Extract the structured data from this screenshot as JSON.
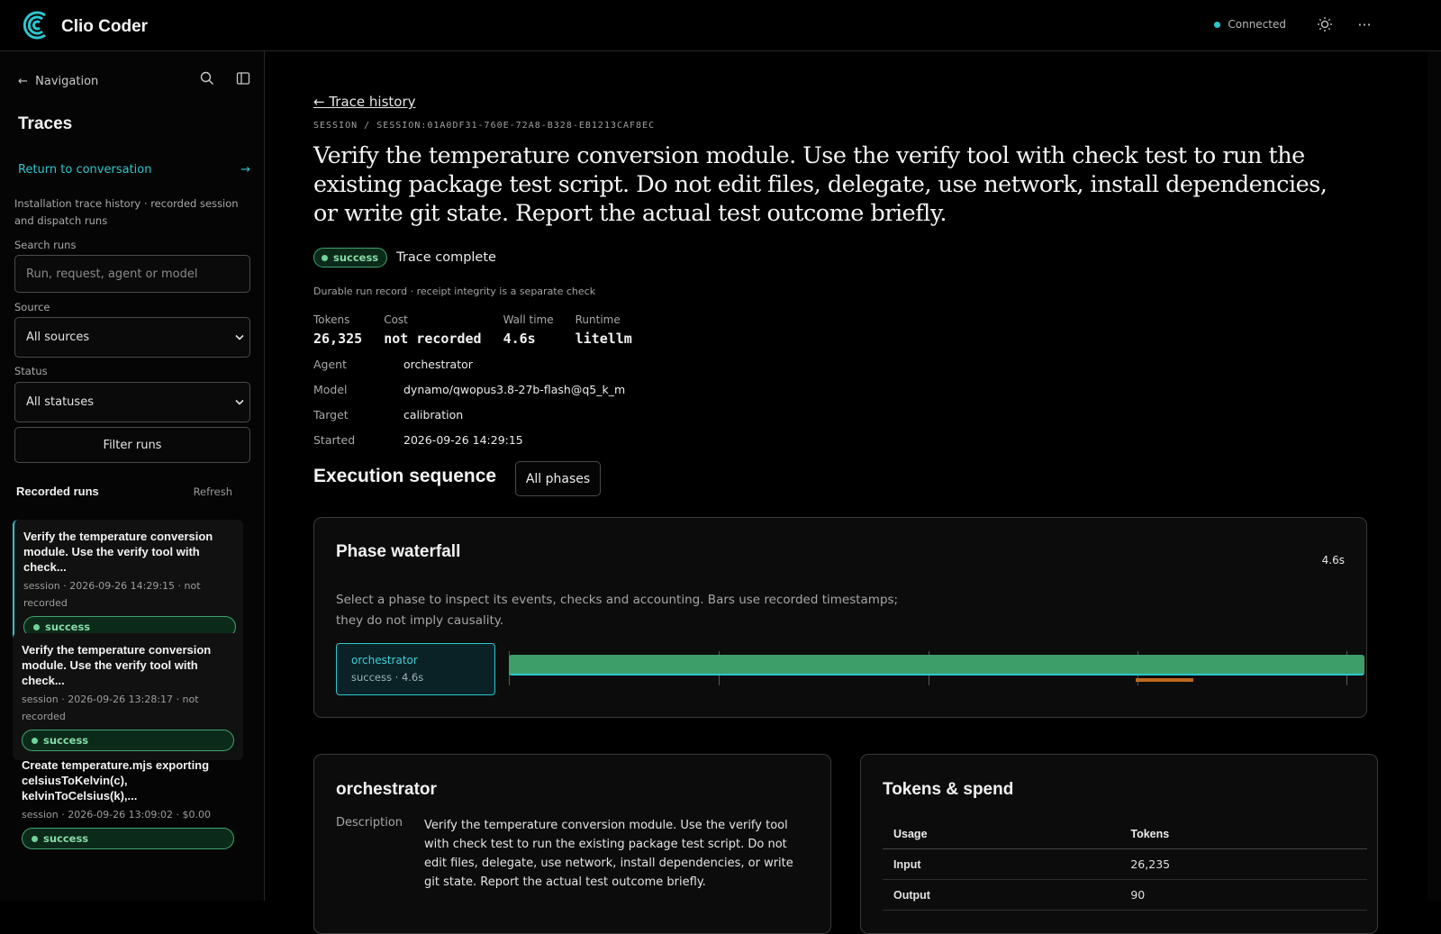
{
  "app": {
    "name": "Clio Coder",
    "connection": "Connected"
  },
  "colors": {
    "accent": "#2cc6cf",
    "success": "#3e9e6a",
    "warn": "#c0681f"
  },
  "icons": {
    "logo": "clio-logo-icon",
    "theme": "sun-icon",
    "more": "more-horizontal-icon",
    "search": "search-icon",
    "panel": "sidebar-toggle-icon"
  },
  "sidebar": {
    "nav_label": "Navigation",
    "title": "Traces",
    "return_link": "Return to conversation",
    "description": "Installation trace history · recorded session and dispatch runs",
    "search_label": "Search runs",
    "search_placeholder": "Run, request, agent or model",
    "source_label": "Source",
    "source_value": "All sources",
    "status_label": "Status",
    "status_value": "All statuses",
    "filter_button": "Filter runs",
    "runs_title": "Recorded runs",
    "refresh": "Refresh",
    "runs": [
      {
        "title": "Verify the temperature conversion module. Use the verify tool with check...",
        "meta": "session · 2026-09-26 14:29:15 · not recorded",
        "status": "success"
      },
      {
        "title": "Verify the temperature conversion module. Use the verify tool with check...",
        "meta": "session · 2026-09-26 13:28:17 · not recorded",
        "status": "success"
      },
      {
        "title": "Create temperature.mjs exporting celsiusToKelvin(c), kelvinToCelsius(k),...",
        "meta": "session · 2026-09-26 13:09:02 · $0.00",
        "status": "success"
      }
    ]
  },
  "main": {
    "back_link": "← Trace history",
    "session_line": "SESSION / SESSION:01A0DF31-760E-72A8-B328-EB1213CAF8EC",
    "headline": "Verify the temperature conversion module. Use the verify tool with check test to run the existing package test script. Do not edit files, delegate, use network, install dependencies, or write git state. Report the actual test outcome briefly.",
    "status_badge": "success",
    "status_text": "Trace complete",
    "durable_note": "Durable run record · receipt integrity is a separate check",
    "metrics": [
      {
        "label": "Tokens",
        "value": "26,325"
      },
      {
        "label": "Cost",
        "value": "not recorded"
      },
      {
        "label": "Wall time",
        "value": "4.6s"
      },
      {
        "label": "Runtime",
        "value": "litellm"
      }
    ],
    "details": [
      {
        "key": "Agent",
        "value": "orchestrator"
      },
      {
        "key": "Model",
        "value": "dynamo/qwopus3.8-27b-flash@q5_k_m"
      },
      {
        "key": "Target",
        "value": "calibration"
      },
      {
        "key": "Started",
        "value": "2026-09-26 14:29:15"
      }
    ],
    "exec_title": "Execution sequence",
    "phases_button": "All phases",
    "waterfall": {
      "title": "Phase waterfall",
      "total": "4.6s",
      "description": "Select a phase to inspect its events, checks and accounting. Bars use recorded timestamps; they do not imply causality.",
      "phase_name": "orchestrator",
      "phase_meta": "success · 4.6s",
      "phase_fraction": 1.0
    },
    "phase_detail": {
      "title": "orchestrator",
      "desc_key": "Description",
      "desc_value": "Verify the temperature conversion module. Use the verify tool with check test to run the existing package test script. Do not edit files, delegate, use network, install dependencies, or write git state. Report the actual test outcome briefly."
    },
    "tokens": {
      "title": "Tokens & spend",
      "headers": [
        "Usage",
        "Tokens"
      ],
      "rows": [
        [
          "Input",
          "26,235"
        ],
        [
          "Output",
          "90"
        ]
      ]
    }
  }
}
